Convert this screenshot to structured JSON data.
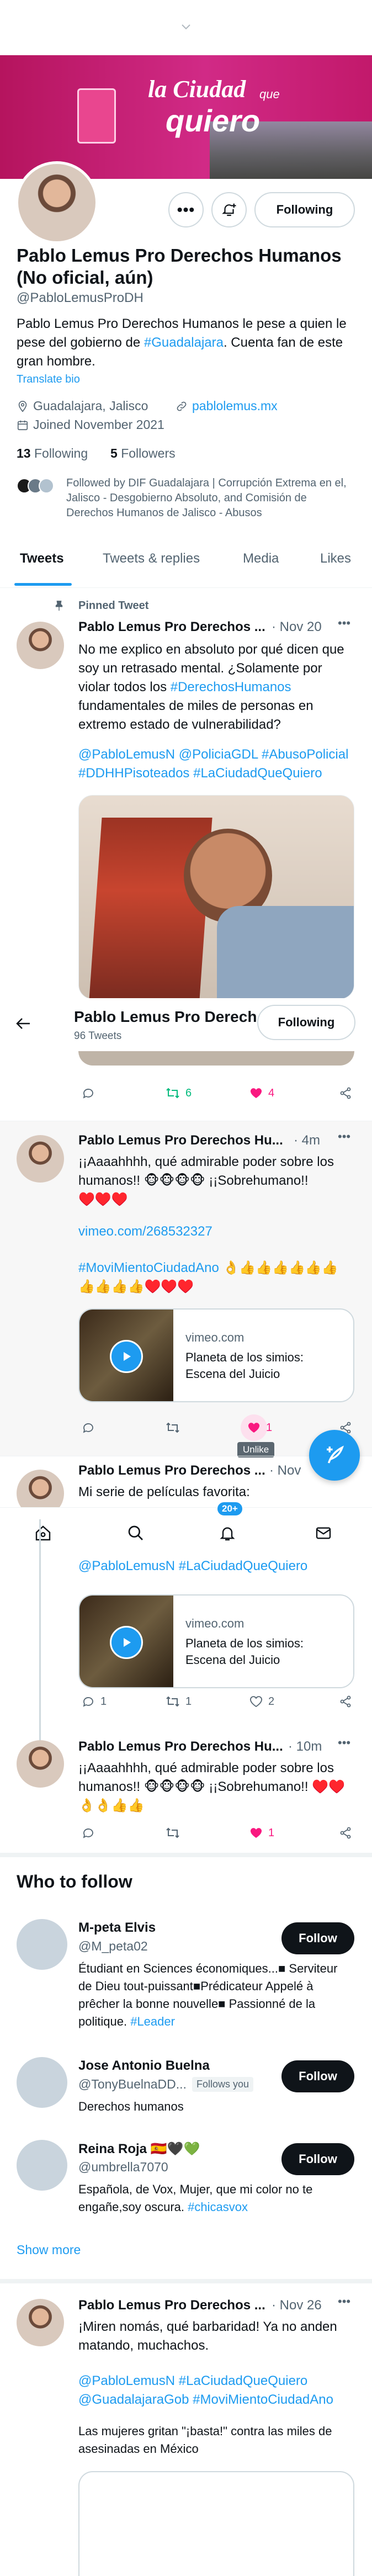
{
  "banner": {
    "tagline_1": "la Ciudad",
    "tagline_2": "quiero",
    "tagline_small": "que"
  },
  "profile": {
    "name_line1": "Pablo Lemus Pro Derechos Humanos",
    "name_line2": "(No oficial, aún)",
    "handle": "@PabloLemusProDH",
    "bio_plain": "Pablo Lemus Pro Derechos Humanos le pese a quien le pese del gobierno de ",
    "bio_link": "#Guadalajara",
    "bio_end": ". Cuenta fan de este gran hombre.",
    "translate": "Translate bio",
    "location": "Guadalajara, Jalisco",
    "website": "pablolemus.mx",
    "joined": "Joined November 2021",
    "following_count": "13",
    "following_label": "Following",
    "followers_count": "5",
    "followers_label": "Followers",
    "followed_by": "Followed by DIF Guadalajara | Corrupción Extrema en el, Jalisco - Desgobierno Absoluto, and Comisión de Derechos Humanos de Jalisco - Abusos",
    "follow_state": "Following"
  },
  "tabs": [
    "Tweets",
    "Tweets & replies",
    "Media",
    "Likes"
  ],
  "sticky_header": {
    "title": "Pablo Lemus Pro Derech...",
    "subtitle": "96 Tweets",
    "button": "Following"
  },
  "pinned": {
    "label": "Pinned Tweet",
    "name": "Pablo Lemus Pro Derechos ...",
    "time": "· Nov 20",
    "text": "No me explico en absoluto por qué dicen que soy un retrasado mental. ¿Solamente por violar todos los",
    "hashtag": "#DerechosHumanos",
    "text2": "fundamentales de miles de personas en extremo estado de vulnerabilidad?",
    "tags": "@PabloLemusN @PoliciaGDL #AbusoPolicial #DDHHPisoteados #LaCiudadQueQuiero",
    "retweets": "6",
    "likes": "4"
  },
  "tweet2": {
    "name": "Pablo Lemus Pro Derechos Hu...",
    "time": "· 4m",
    "text": "¡¡Aaaahhhh, qué admirable poder sobre los humanos!! 🐵🐵🐵🐵 ¡¡Sobrehumano!! ♥️♥️♥️",
    "link": "vimeo.com/268532327",
    "tags": "#MoviMientoCiudadAno",
    "emoji_tail": "👌👍👍👍👍👍👍👍👍👍👍♥️♥️♥️",
    "card_domain": "vimeo.com",
    "card_title": "Planeta de los simios: Escena del Juicio",
    "likes": "1",
    "tooltip": "Unlike"
  },
  "tweet3": {
    "name": "Pablo Lemus Pro Derechos ...",
    "time": "· Nov",
    "text": "Mi serie de películas favorita:",
    "tags": "@PabloLemusN #LaCiudadQueQuiero",
    "card_domain": "vimeo.com",
    "card_title": "Planeta de los simios: Escena del Juicio",
    "replies": "1",
    "retweets": "1",
    "likes": "2"
  },
  "bottom_nav": {
    "badge": "20+"
  },
  "tweet4": {
    "name": "Pablo Lemus Pro Derechos Hu...",
    "time": "· 10m",
    "text": "¡¡Aaaahhhh, qué admirable poder sobre los humanos!! 🐵🐵🐵🐵 ¡¡Sobrehumano!! ♥️♥️ 👌👌👍👍",
    "likes": "1"
  },
  "who_to_follow": {
    "title": "Who to follow",
    "users": [
      {
        "name": "M-peta Elvis",
        "handle": "@M_peta02",
        "follows_you": "",
        "bio": "Étudiant en Sciences économiques...■ Serviteur de Dieu tout-puissant■Prédicateur Appelé à prêcher la bonne nouvelle■ Passionné de la politique. ",
        "bio_link": "#Leader",
        "button": "Follow"
      },
      {
        "name": "Jose Antonio Buelna",
        "handle": "@TonyBuelnaDD...",
        "follows_you": "Follows you",
        "bio": "Derechos humanos",
        "bio_link": "",
        "button": "Follow"
      },
      {
        "name": "Reina Roja 🇪🇸🖤💚",
        "handle": "@umbrella7070",
        "follows_you": "",
        "bio": "Española, de Vox, Mujer, que mi color no te engañe,soy oscura. ",
        "bio_link": "#chicasvox",
        "button": "Follow"
      }
    ],
    "show_more": "Show more"
  },
  "tweet5": {
    "name": "Pablo Lemus Pro Derechos ...",
    "time": "· Nov 26",
    "text": "¡Miren nomás, qué barbaridad! Ya no anden matando, muchachos.",
    "tags": "@PabloLemusN #LaCiudadQueQuiero @GuadalajaraGob #MoviMientoCiudadAno",
    "text2": "Las mujeres gritan \"¡basta!\" contra las miles de asesinadas en México"
  },
  "colors": {
    "accent": "#1d9bf0",
    "like": "#f91880",
    "retweet": "#00ba7c",
    "banner": "#c2196b"
  }
}
